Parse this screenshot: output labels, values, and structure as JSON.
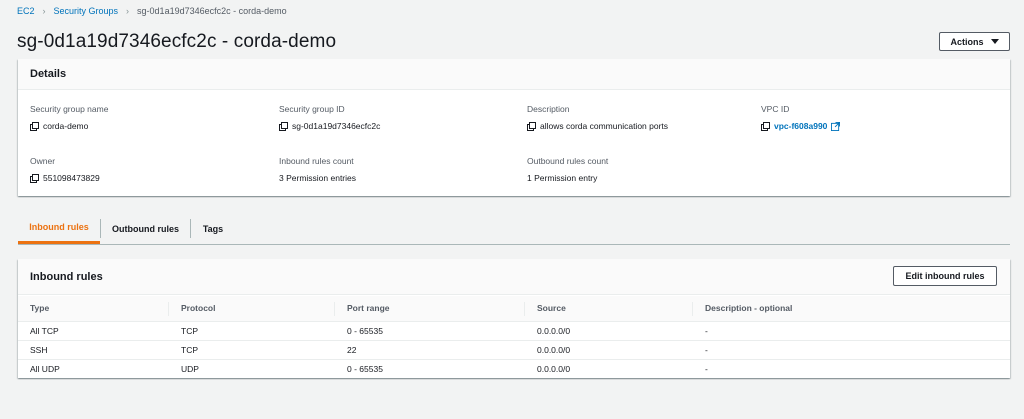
{
  "breadcrumb": {
    "items": [
      "EC2",
      "Security Groups",
      "sg-0d1a19d7346ecfc2c - corda-demo"
    ]
  },
  "page": {
    "title": "sg-0d1a19d7346ecfc2c - corda-demo",
    "actions_label": "Actions"
  },
  "details": {
    "title": "Details",
    "fields": [
      {
        "label": "Security group name",
        "value": "corda-demo"
      },
      {
        "label": "Security group ID",
        "value": "sg-0d1a19d7346ecfc2c"
      },
      {
        "label": "Description",
        "value": "allows corda communication ports"
      },
      {
        "label": "VPC ID",
        "value": "vpc-f608a990"
      },
      {
        "label": "Owner",
        "value": "551098473829"
      },
      {
        "label": "Inbound rules count",
        "value": "3 Permission entries"
      },
      {
        "label": "Outbound rules count",
        "value": "1 Permission entry"
      }
    ]
  },
  "tabs": [
    "Inbound rules",
    "Outbound rules",
    "Tags"
  ],
  "inbound": {
    "title": "Inbound rules",
    "edit_label": "Edit inbound rules",
    "columns": [
      "Type",
      "Protocol",
      "Port range",
      "Source",
      "Description - optional"
    ],
    "rows": [
      [
        "All TCP",
        "TCP",
        "0 - 65535",
        "0.0.0.0/0",
        "-"
      ],
      [
        "SSH",
        "TCP",
        "22",
        "0.0.0.0/0",
        "-"
      ],
      [
        "All UDP",
        "UDP",
        "0 - 65535",
        "0.0.0.0/0",
        "-"
      ]
    ]
  },
  "colors": {
    "link": "#0073bb",
    "active_tab": "#ec7211"
  }
}
